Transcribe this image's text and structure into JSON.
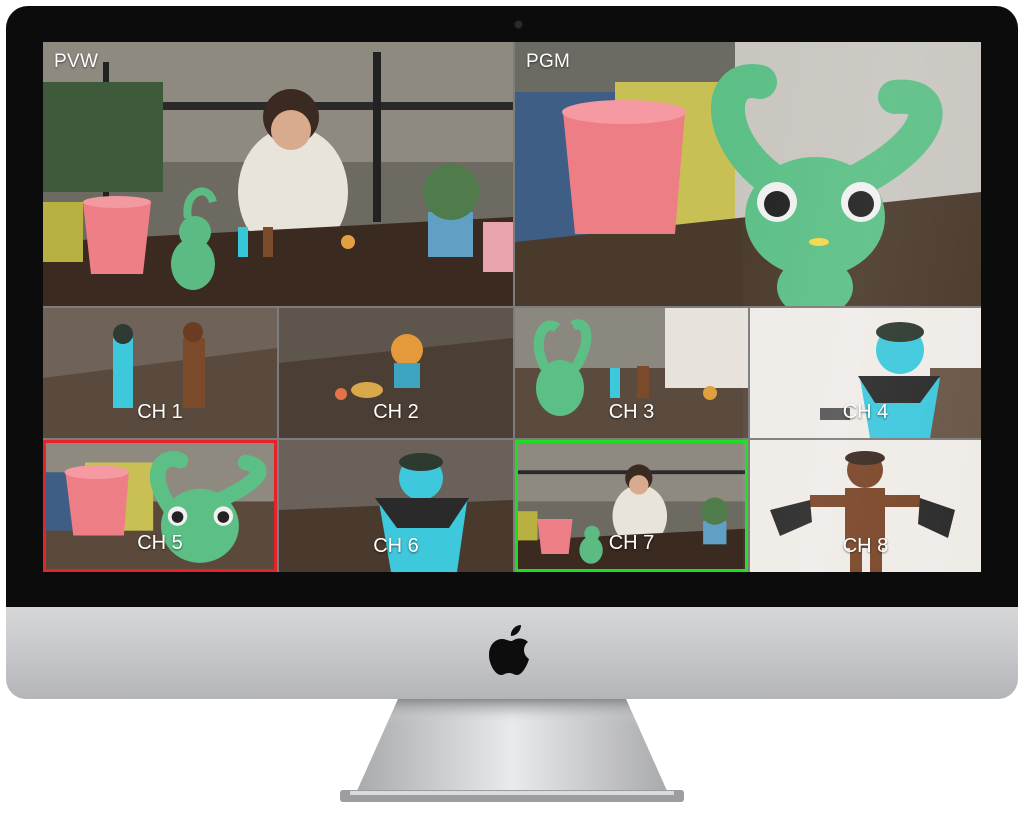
{
  "multiview": {
    "preview": {
      "label": "PVW"
    },
    "program": {
      "label": "PGM"
    },
    "channels": [
      {
        "label": "CH 1"
      },
      {
        "label": "CH 2"
      },
      {
        "label": "CH 3"
      },
      {
        "label": "CH 4"
      },
      {
        "label": "CH 5",
        "tally": "preview",
        "tally_color": "#e6232a"
      },
      {
        "label": "CH 6"
      },
      {
        "label": "CH 7",
        "tally": "program",
        "tally_color": "#1fdc22"
      },
      {
        "label": "CH 8"
      }
    ]
  },
  "device": {
    "logo_icon": "apple-logo-icon"
  }
}
